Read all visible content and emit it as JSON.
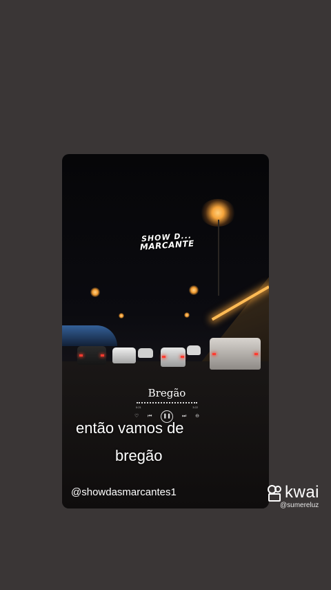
{
  "video": {
    "logo_line1": "SHOW D...",
    "logo_line2": "MARCANTE",
    "player": {
      "song_title": "Bregão",
      "time_elapsed": "0:21",
      "time_total": "3:22",
      "icons": [
        "heart-icon",
        "previous-icon",
        "pause-icon",
        "next-icon",
        "minus-icon"
      ]
    },
    "lyrics_line1": "então vamos  de",
    "lyrics_line2": "bregão",
    "creator_handle": "@showdasmarcantes1"
  },
  "watermark": {
    "brand": "kwai",
    "user": "@sumereluz"
  },
  "colors": {
    "background": "#3a3636",
    "street_light": "#f5a33a",
    "text": "#ffffff"
  }
}
